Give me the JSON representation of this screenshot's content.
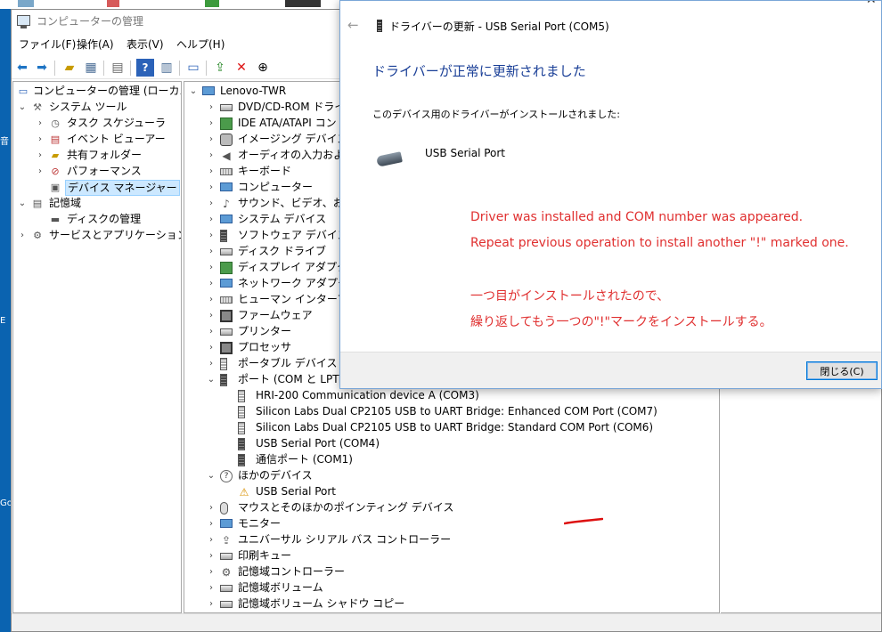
{
  "window": {
    "title": "コンピューターの管理",
    "menu": [
      "ファイル(F)",
      "操作(A)",
      "表示(V)",
      "ヘルプ(H)"
    ]
  },
  "tree": [
    {
      "label": "コンピューターの管理 (ローカル)",
      "icon": "computer-management-icon"
    },
    {
      "label": "システム ツール",
      "icon": "tools-icon"
    },
    {
      "label": "タスク スケジューラ",
      "icon": "clock-icon"
    },
    {
      "label": "イベント ビューアー",
      "icon": "event-viewer-icon"
    },
    {
      "label": "共有フォルダー",
      "icon": "shared-folder-icon"
    },
    {
      "label": "パフォーマンス",
      "icon": "performance-icon"
    },
    {
      "label": "デバイス マネージャー",
      "icon": "device-manager-icon"
    },
    {
      "label": "記憶域",
      "icon": "storage-icon"
    },
    {
      "label": "ディスクの管理",
      "icon": "disk-icon"
    },
    {
      "label": "サービスとアプリケーション",
      "icon": "services-icon"
    }
  ],
  "devices": {
    "root": "Lenovo-TWR",
    "categories": [
      "DVD/CD-ROM ドライブ",
      "IDE ATA/ATAPI コントローラー",
      "イメージング デバイス",
      "オーディオの入力および出力",
      "キーボード",
      "コンピューター",
      "サウンド、ビデオ、およびゲーム コントローラー",
      "システム デバイス",
      "ソフトウェア デバイス",
      "ディスク ドライブ",
      "ディスプレイ アダプター",
      "ネットワーク アダプター",
      "ヒューマン インターフェイス デバイス",
      "ファームウェア",
      "プリンター",
      "プロセッサ",
      "ポータブル デバイス"
    ],
    "ports_label": "ポート (COM と LPT)",
    "ports": [
      "HRI-200 Communication device A (COM3)",
      "Silicon Labs Dual CP2105 USB to UART Bridge: Enhanced COM Port (COM7)",
      "Silicon Labs Dual CP2105 USB to UART Bridge: Standard COM Port (COM6)",
      "USB Serial Port (COM4)",
      "通信ポート (COM1)"
    ],
    "other_label": "ほかのデバイス",
    "other": [
      "USB Serial Port"
    ],
    "after": [
      "マウスとそのほかのポインティング デバイス",
      "モニター",
      "ユニバーサル シリアル バス コントローラー",
      "印刷キュー",
      "記憶域コントローラー",
      "記憶域ボリューム",
      "記憶域ボリューム シャドウ コピー"
    ]
  },
  "dialog": {
    "title": "ドライバーの更新 - USB Serial Port (COM5)",
    "heading": "ドライバーが正常に更新されました",
    "subtitle": "このデバイス用のドライバーがインストールされました:",
    "device_name": "USB Serial Port",
    "close_button": "閉じる(C)"
  },
  "annotations": {
    "en_line1": "Driver was installed and COM number was appeared.",
    "en_line2": "Repeat previous operation to install another \"!\" marked one.",
    "jp_line1": "一つ目がインストールされたので、",
    "jp_line2": "繰り返してもう一つの\"!\"マークをインストールする。",
    "color": "#e03030"
  }
}
